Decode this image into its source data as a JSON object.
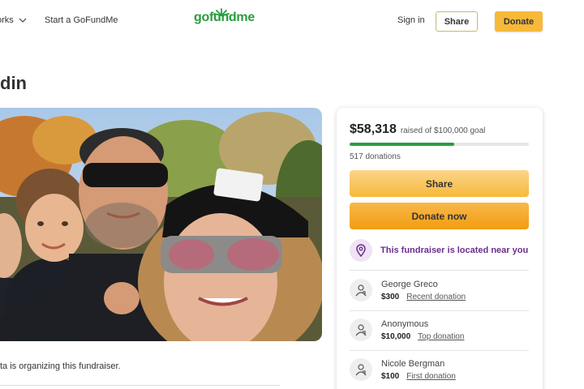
{
  "header": {
    "nav_works": "orks",
    "nav_start": "Start a GoFundMe",
    "logo": "gofundme",
    "signin": "Sign in",
    "share_label": "Share",
    "donate_label": "Donate"
  },
  "title": "din",
  "organizer_text": "ta is organizing this fundraiser.",
  "card": {
    "raised_amount": "$58,318",
    "raised_goal": "raised of $100,000 goal",
    "progress_fraction": 0.583,
    "donation_count": "517 donations",
    "share_label": "Share",
    "donate_label": "Donate now",
    "location_text": "This fundraiser is located near you",
    "donors": [
      {
        "name": "George Greco",
        "amount": "$300",
        "tag": "Recent donation"
      },
      {
        "name": "Anonymous",
        "amount": "$10,000",
        "tag": "Top donation"
      },
      {
        "name": "Nicole Bergman",
        "amount": "$100",
        "tag": "First donation"
      }
    ]
  },
  "colors": {
    "brand_green": "#2a9d3f",
    "donate_orange": "#f39c12",
    "share_yellow": "#f6b93a",
    "location_purple": "#6a2e8c"
  },
  "icons": {
    "chevron": "chevron-down-icon",
    "location": "location-pin-icon",
    "avatar": "user-avatar-icon"
  }
}
